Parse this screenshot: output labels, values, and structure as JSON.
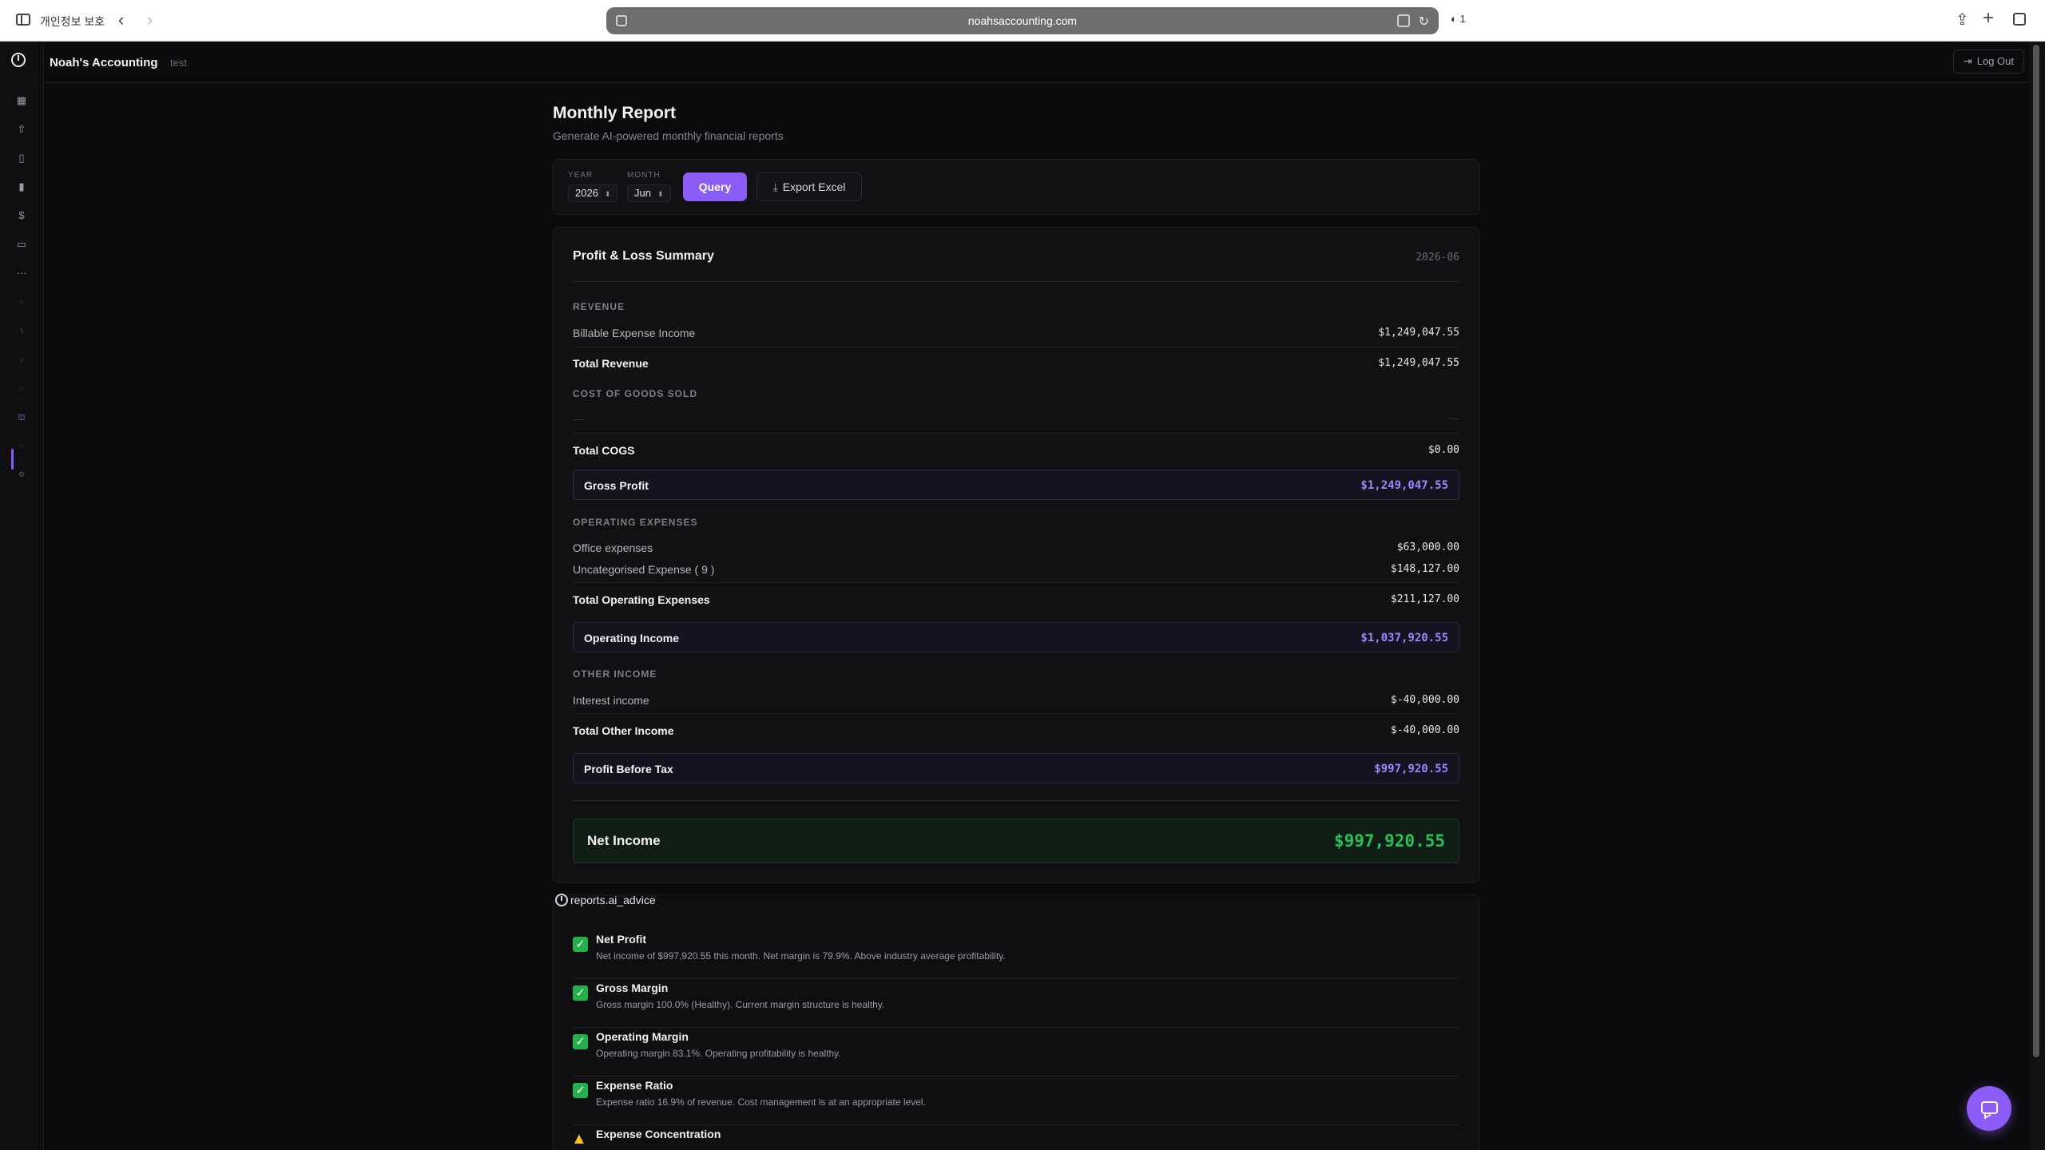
{
  "browser": {
    "privacy_label": "개인정보 보호",
    "url": "noahsaccounting.com",
    "shield_count": "1"
  },
  "app": {
    "brand": "Noah's Accounting",
    "workspace": "test",
    "logout_label": "Log Out"
  },
  "page": {
    "title": "Monthly Report",
    "subtitle": "Generate AI-powered monthly financial reports"
  },
  "filters": {
    "year_label": "YEAR",
    "year_value": "2026",
    "month_label": "MONTH",
    "month_value": "Jun",
    "query_label": "Query",
    "export_label": "Export Excel"
  },
  "pl": {
    "title": "Profit & Loss Summary",
    "period": "2026-06",
    "revenue_label": "REVENUE",
    "revenue_rows": [
      {
        "name": "Billable Expense Income",
        "amount": "$1,249,047.55"
      }
    ],
    "total_revenue_label": "Total Revenue",
    "total_revenue": "$1,249,047.55",
    "cogs_label": "COST OF GOODS SOLD",
    "cogs_empty_left": "—",
    "cogs_empty_right": "—",
    "total_cogs_label": "Total COGS",
    "total_cogs": "$0.00",
    "gross_profit_label": "Gross Profit",
    "gross_profit": "$1,249,047.55",
    "opex_label": "OPERATING EXPENSES",
    "opex_rows": [
      {
        "name": "Office expenses",
        "amount": "$63,000.00"
      },
      {
        "name": "Uncategorised Expense ( 9 )",
        "amount": "$148,127.00"
      }
    ],
    "total_opex_label": "Total Operating Expenses",
    "total_opex": "$211,127.00",
    "operating_income_label": "Operating Income",
    "operating_income": "$1,037,920.55",
    "other_income_label": "OTHER INCOME",
    "other_rows": [
      {
        "name": "Interest income",
        "amount": "$-40,000.00"
      }
    ],
    "total_other_label": "Total Other Income",
    "total_other": "$-40,000.00",
    "pbt_label": "Profit Before Tax",
    "pbt": "$997,920.55",
    "net_income_label": "Net Income",
    "net_income": "$997,920.55"
  },
  "ai": {
    "heading": "reports.ai_advice",
    "items": [
      {
        "title": "Net Profit",
        "desc": "Net income of $997,920.55 this month. Net margin is 79.9%. Above industry average profitability.",
        "status": "ok"
      },
      {
        "title": "Gross Margin",
        "desc": "Gross margin 100.0% (Healthy). Current margin structure is healthy.",
        "status": "ok"
      },
      {
        "title": "Operating Margin",
        "desc": "Operating margin 83.1%. Operating profitability is healthy.",
        "status": "ok"
      },
      {
        "title": "Expense Ratio",
        "desc": "Expense ratio 16.9% of revenue. Cost management is at an appropriate level.",
        "status": "ok"
      },
      {
        "title": "Expense Concentration",
        "desc": "",
        "status": "warn"
      }
    ]
  },
  "colors": {
    "accent": "#8b5cf6",
    "positive": "#26c15c",
    "background": "#0b0b0d"
  }
}
